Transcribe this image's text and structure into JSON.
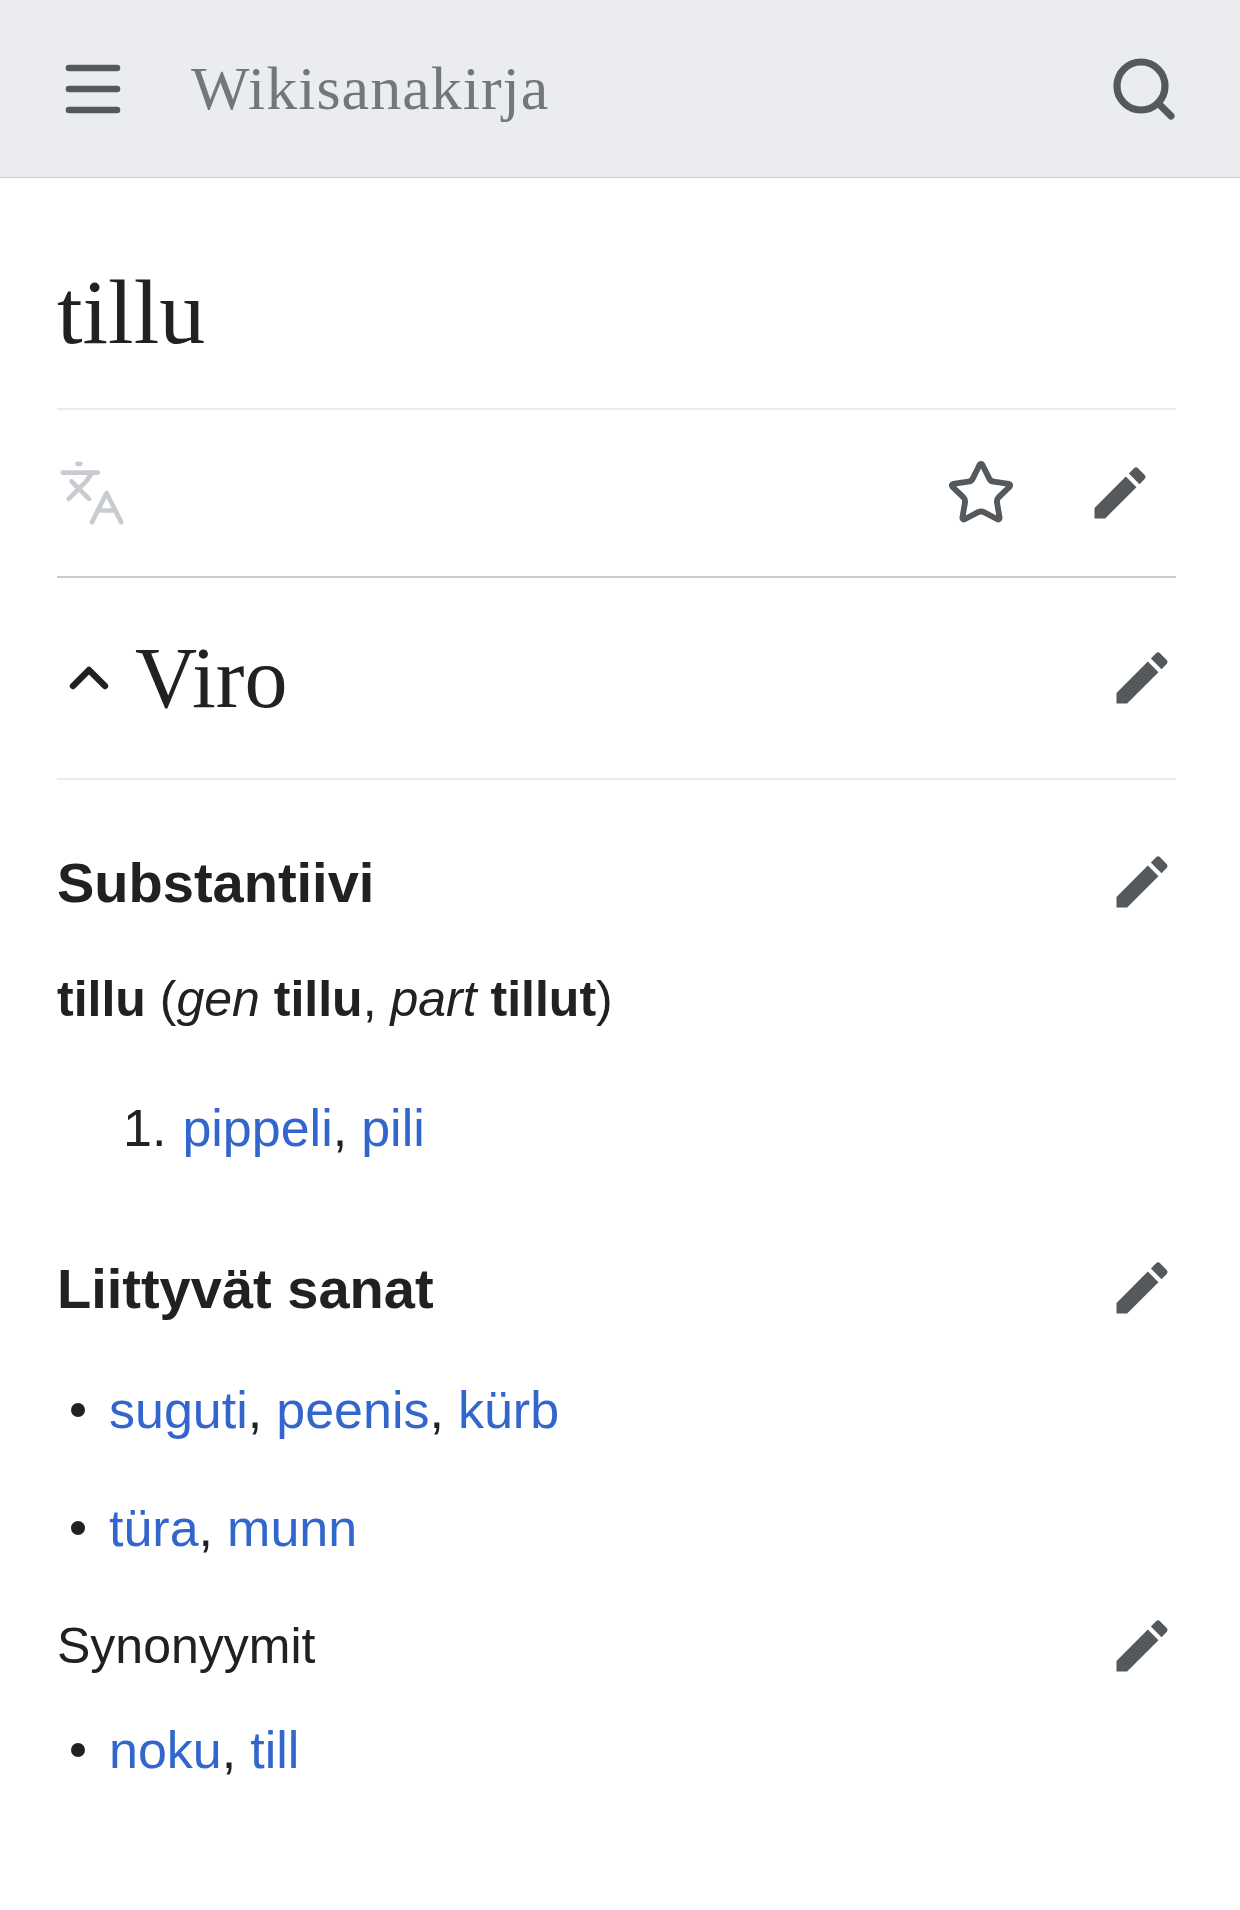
{
  "header": {
    "title": "Wikisanakirja"
  },
  "page": {
    "title": "tillu"
  },
  "section": {
    "heading": "Viro",
    "expanded": true,
    "editable": true,
    "blocks": [
      {
        "kind": "heading",
        "text": "Substantiivi",
        "bold": true,
        "editable": true
      },
      {
        "kind": "headword",
        "text": "**tillu** (*gen* **tillu**, *part* **tillut**)"
      },
      {
        "kind": "numbered",
        "items": [
          {
            "number": "1.",
            "links": [
              "pippeli",
              "pili"
            ]
          }
        ]
      },
      {
        "kind": "heading",
        "text": "Liittyvät sanat",
        "bold": true,
        "editable": true
      },
      {
        "kind": "bullets",
        "items": [
          {
            "links": [
              "suguti",
              "peenis",
              "kürb"
            ]
          },
          {
            "links": [
              "türa",
              "munn"
            ]
          }
        ]
      },
      {
        "kind": "heading",
        "text": "Synonyymit",
        "bold": false,
        "editable": true
      },
      {
        "kind": "bullets",
        "items": [
          {
            "links": [
              "noku",
              "till"
            ]
          }
        ]
      }
    ]
  },
  "separator": ","
}
